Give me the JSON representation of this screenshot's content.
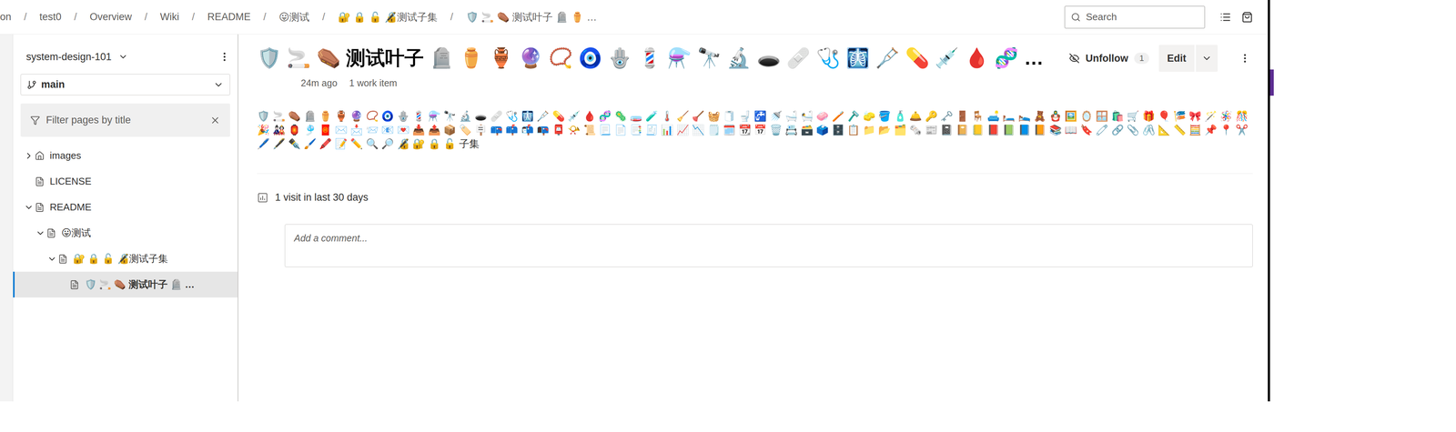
{
  "breadcrumb": [
    "on",
    "test0",
    "Overview",
    "Wiki",
    "README",
    "😛测试",
    "🔐 🔒 🔓 🔏测试子集",
    "🛡️ 🚬 ⚰️ 测试叶子 🪦 ⚱️ …"
  ],
  "search": {
    "placeholder": "Search"
  },
  "sidebar": {
    "repo": "system-design-101",
    "branch": "main",
    "filter": {
      "placeholder": "Filter pages by title"
    },
    "tree": [
      {
        "label": "images",
        "depth": 0,
        "kind": "home",
        "expandable": true,
        "expanded": false,
        "selected": false
      },
      {
        "label": "LICENSE",
        "depth": 0,
        "kind": "page",
        "expandable": false,
        "expanded": false,
        "selected": false
      },
      {
        "label": "README",
        "depth": 0,
        "kind": "page",
        "expandable": true,
        "expanded": true,
        "selected": false
      },
      {
        "label": "😛测试",
        "depth": 1,
        "kind": "page",
        "expandable": true,
        "expanded": true,
        "selected": false
      },
      {
        "label": "🔐 🔒 🔓 🔏测试子集",
        "depth": 2,
        "kind": "page",
        "expandable": true,
        "expanded": true,
        "selected": false
      },
      {
        "label": "🛡️ 🚬 ⚰️ 测试叶子 🪦 …",
        "depth": 3,
        "kind": "page",
        "expandable": false,
        "expanded": false,
        "selected": true
      }
    ]
  },
  "page": {
    "title": "🛡️ 🚬 ⚰️ 测试叶子 🪦 ⚱️ 🏺 🔮 📿 🧿 🪬 💈 ⚗️ 🔭 🔬 🕳️ 🩹 🩺 🩻 🩼 💊 💉 🩸 🧬 …",
    "follow": {
      "label": "Unfollow",
      "count": "1"
    },
    "edit": "Edit",
    "updated": "24m ago",
    "work_items": "1 work item",
    "content": "🛡️ 🚬 ⚰️ 🪦 ⚱️ 🏺 🔮 📿 🧿 🪬 💈 ⚗️ 🔭 🔬 🕳️ 🩹 🩺 🩻 🩼 💊 💉 🩸 🧬 🦠 🧫 🧪 🌡️ 🧹 🪠 🧺 🧻 🚽 🚰 🚿 🛁 🛀 🧼 🪥 🪒 🧽 🪣 🧴 🛎️ 🔑 🗝️ 🚪 🪑 🛋️ 🛏️ 🛌 🧸 🪆 🖼️ 🪞 🪟 🛍️ 🛒 🎁 🎈 🎏 🎀 🪄 🪅 🎊 🎉 🎎 🏮 🎐 🧧 ✉️ 📩 📨 📧 💌 📥 📤 📦 🏷️ 🪧 📪 📫 📬 📭 📮 📯 📜 📃 📄 📑 🧾 📊 📈 📉 🗒️ 🗓️ 📆 📅 🗑️ 📇 🗃️ 🗳️ 🗄️ 📋 📁 📂 🗂️ 🗞️ 📰 📓 📔 📒 📕 📗 📘 📙 📚 📖 🔖 🧷 🔗 📎 🖇️ 📐 📏 🧮 📌 📍 ✂️ 🖊️ 🖋️ ✒️ 🖌️ 🖍️ 📝 ✏️ 🔍 🔎 🔏 🔐 🔒 🔓 子集",
    "visits": "1 visit in last 30 days",
    "comment": {
      "placeholder": "Add a comment..."
    }
  }
}
